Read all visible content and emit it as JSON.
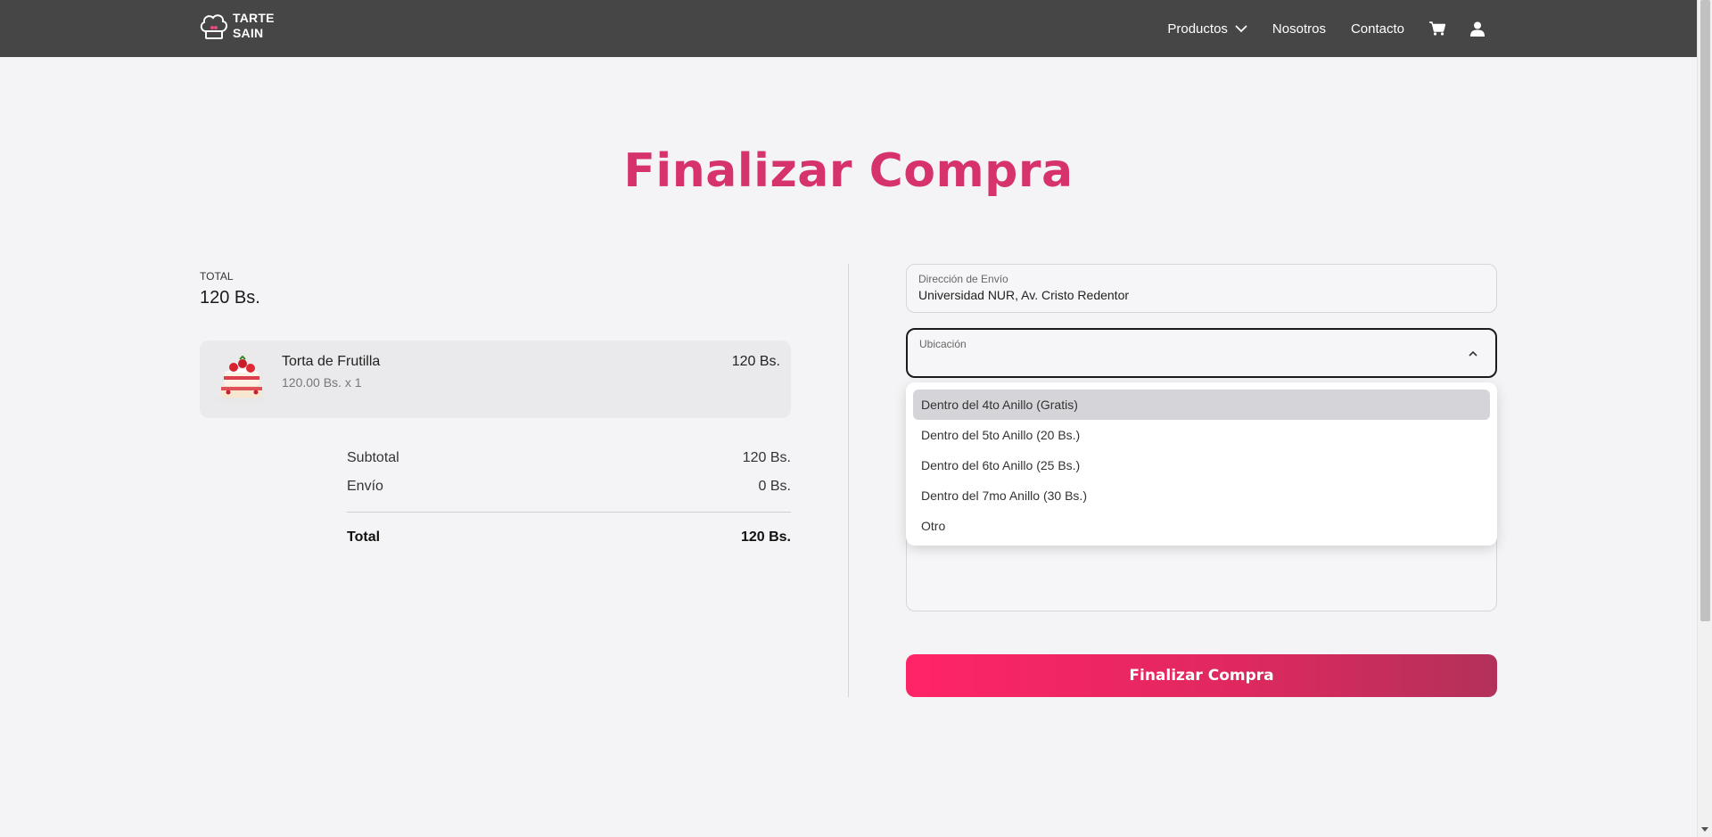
{
  "brand": {
    "line1": "TARTE",
    "line2": "SAIN"
  },
  "nav": {
    "items": [
      {
        "label": "Productos"
      },
      {
        "label": "Nosotros"
      },
      {
        "label": "Contacto"
      }
    ],
    "cart_icon": "cart-icon",
    "user_icon": "user-icon"
  },
  "page": {
    "title": "Finalizar Compra"
  },
  "summary": {
    "total_label": "TOTAL",
    "total_value": "120 Bs.",
    "item": {
      "name": "Torta de Frutilla",
      "detail": "120.00 Bs. x 1",
      "price": "120 Bs."
    },
    "subtotal_label": "Subtotal",
    "subtotal_value": "120 Bs.",
    "shipping_label": "Envío",
    "shipping_value": "0 Bs.",
    "grand_total_label": "Total",
    "grand_total_value": "120 Bs."
  },
  "form": {
    "address": {
      "label": "Dirección de Envío",
      "value": "Universidad NUR, Av. Cristo Redentor"
    },
    "location": {
      "label": "Ubicación",
      "value": "",
      "options": [
        "Dentro del 4to Anillo (Gratis)",
        "Dentro del 5to Anillo (20 Bs.)",
        "Dentro del 6to Anillo (25 Bs.)",
        "Dentro del 7mo Anillo (30 Bs.)",
        "Otro"
      ],
      "highlighted_index": 0
    },
    "submit_label": "Finalizar Compra"
  },
  "colors": {
    "accent": "#d6336c",
    "topbar": "#464646",
    "button_start": "#ff2468",
    "button_end": "#b2315a"
  }
}
